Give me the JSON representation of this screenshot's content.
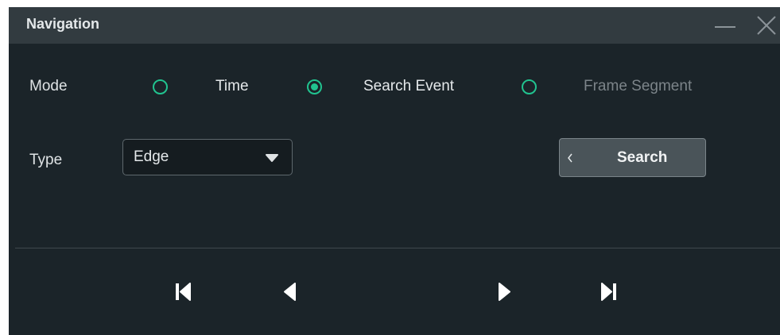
{
  "window": {
    "title": "Navigation"
  },
  "mode": {
    "label": "Mode",
    "options": [
      {
        "label": "Time",
        "selected": false,
        "enabled": true
      },
      {
        "label": "Search Event",
        "selected": true,
        "enabled": true
      },
      {
        "label": "Frame Segment",
        "selected": false,
        "enabled": false
      }
    ]
  },
  "type": {
    "label": "Type",
    "value": "Edge"
  },
  "search": {
    "label": "Search"
  },
  "icons": {
    "minimize": "minimize-icon",
    "close": "close-icon",
    "dropdown": "caret-down-icon",
    "expand": "chevron-left-icon",
    "first": "skip-to-first-icon",
    "prev": "previous-icon",
    "next": "next-icon",
    "last": "skip-to-last-icon"
  },
  "colors": {
    "panel_bg": "#1b2429",
    "titlebar_bg": "#323b40",
    "accent": "#21c38f",
    "text": "#e4e8ea",
    "disabled_text": "#7c8489",
    "button_bg": "#4a5459"
  }
}
